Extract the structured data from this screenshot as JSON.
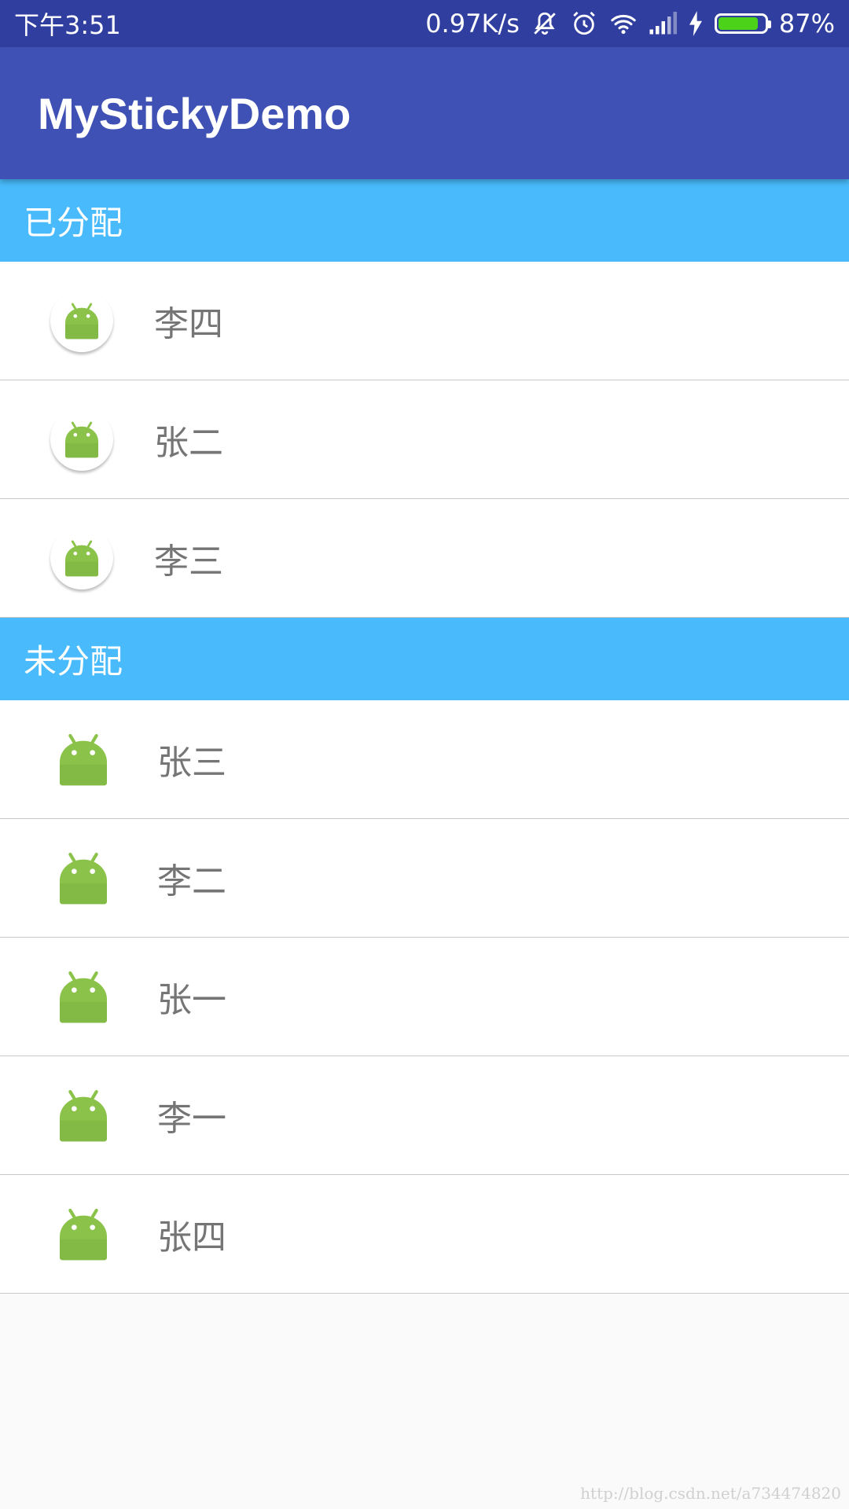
{
  "status_bar": {
    "time": "下午3:51",
    "speed": "0.97K/s",
    "battery_percent": "87%",
    "battery_level": 0.87,
    "icons": [
      "mute-icon",
      "alarm-icon",
      "wifi-icon",
      "signal-icon",
      "charging-icon",
      "battery-icon"
    ]
  },
  "app_bar": {
    "title": "MyStickyDemo"
  },
  "sections": [
    {
      "header": "已分配",
      "avatar_style": "circle",
      "items": [
        {
          "label": "李四"
        },
        {
          "label": "张二"
        },
        {
          "label": "李三"
        }
      ]
    },
    {
      "header": "未分配",
      "avatar_style": "plain",
      "items": [
        {
          "label": "张三"
        },
        {
          "label": "李二"
        },
        {
          "label": "张一"
        },
        {
          "label": "李一"
        },
        {
          "label": "张四"
        }
      ]
    }
  ],
  "watermark": "http://blog.csdn.net/a734474820",
  "colors": {
    "status_bar": "#303f9f",
    "app_bar": "#3f51b5",
    "section_header": "#49bbfc",
    "android_green": "#8bc34a"
  }
}
